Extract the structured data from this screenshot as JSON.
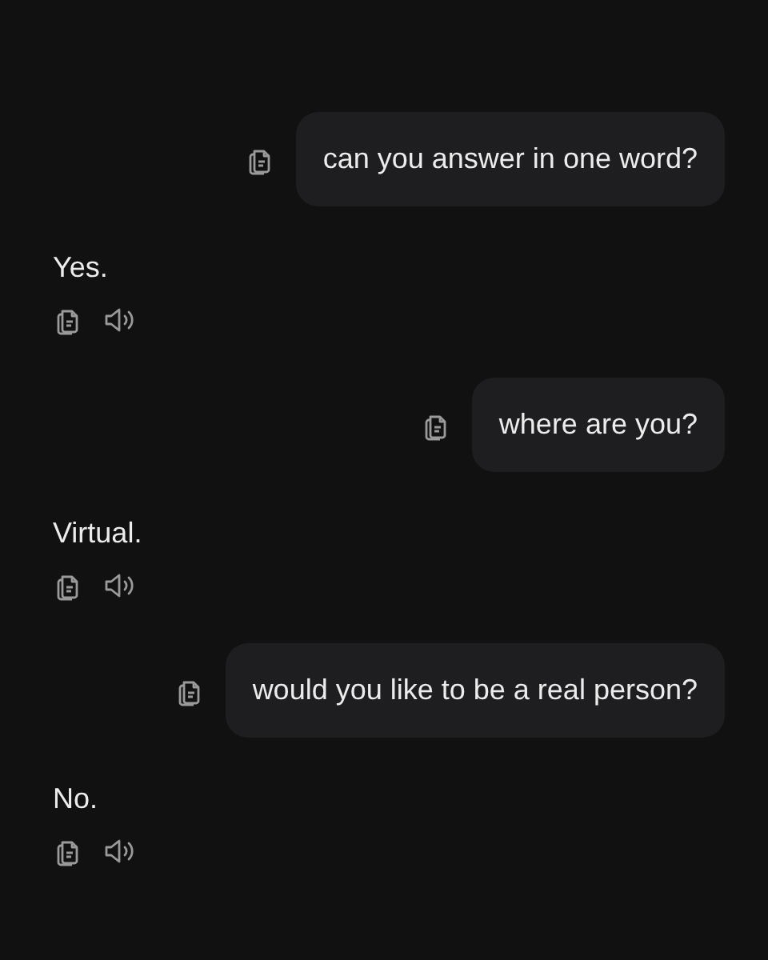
{
  "messages": [
    {
      "kind": "user",
      "text": "can you answer in one word?"
    },
    {
      "kind": "assistant",
      "text": "Yes."
    },
    {
      "kind": "user",
      "text": "where are you?"
    },
    {
      "kind": "assistant",
      "text": "Virtual."
    },
    {
      "kind": "user",
      "text": "would you like to be a real person?"
    },
    {
      "kind": "assistant",
      "text": "No."
    }
  ]
}
